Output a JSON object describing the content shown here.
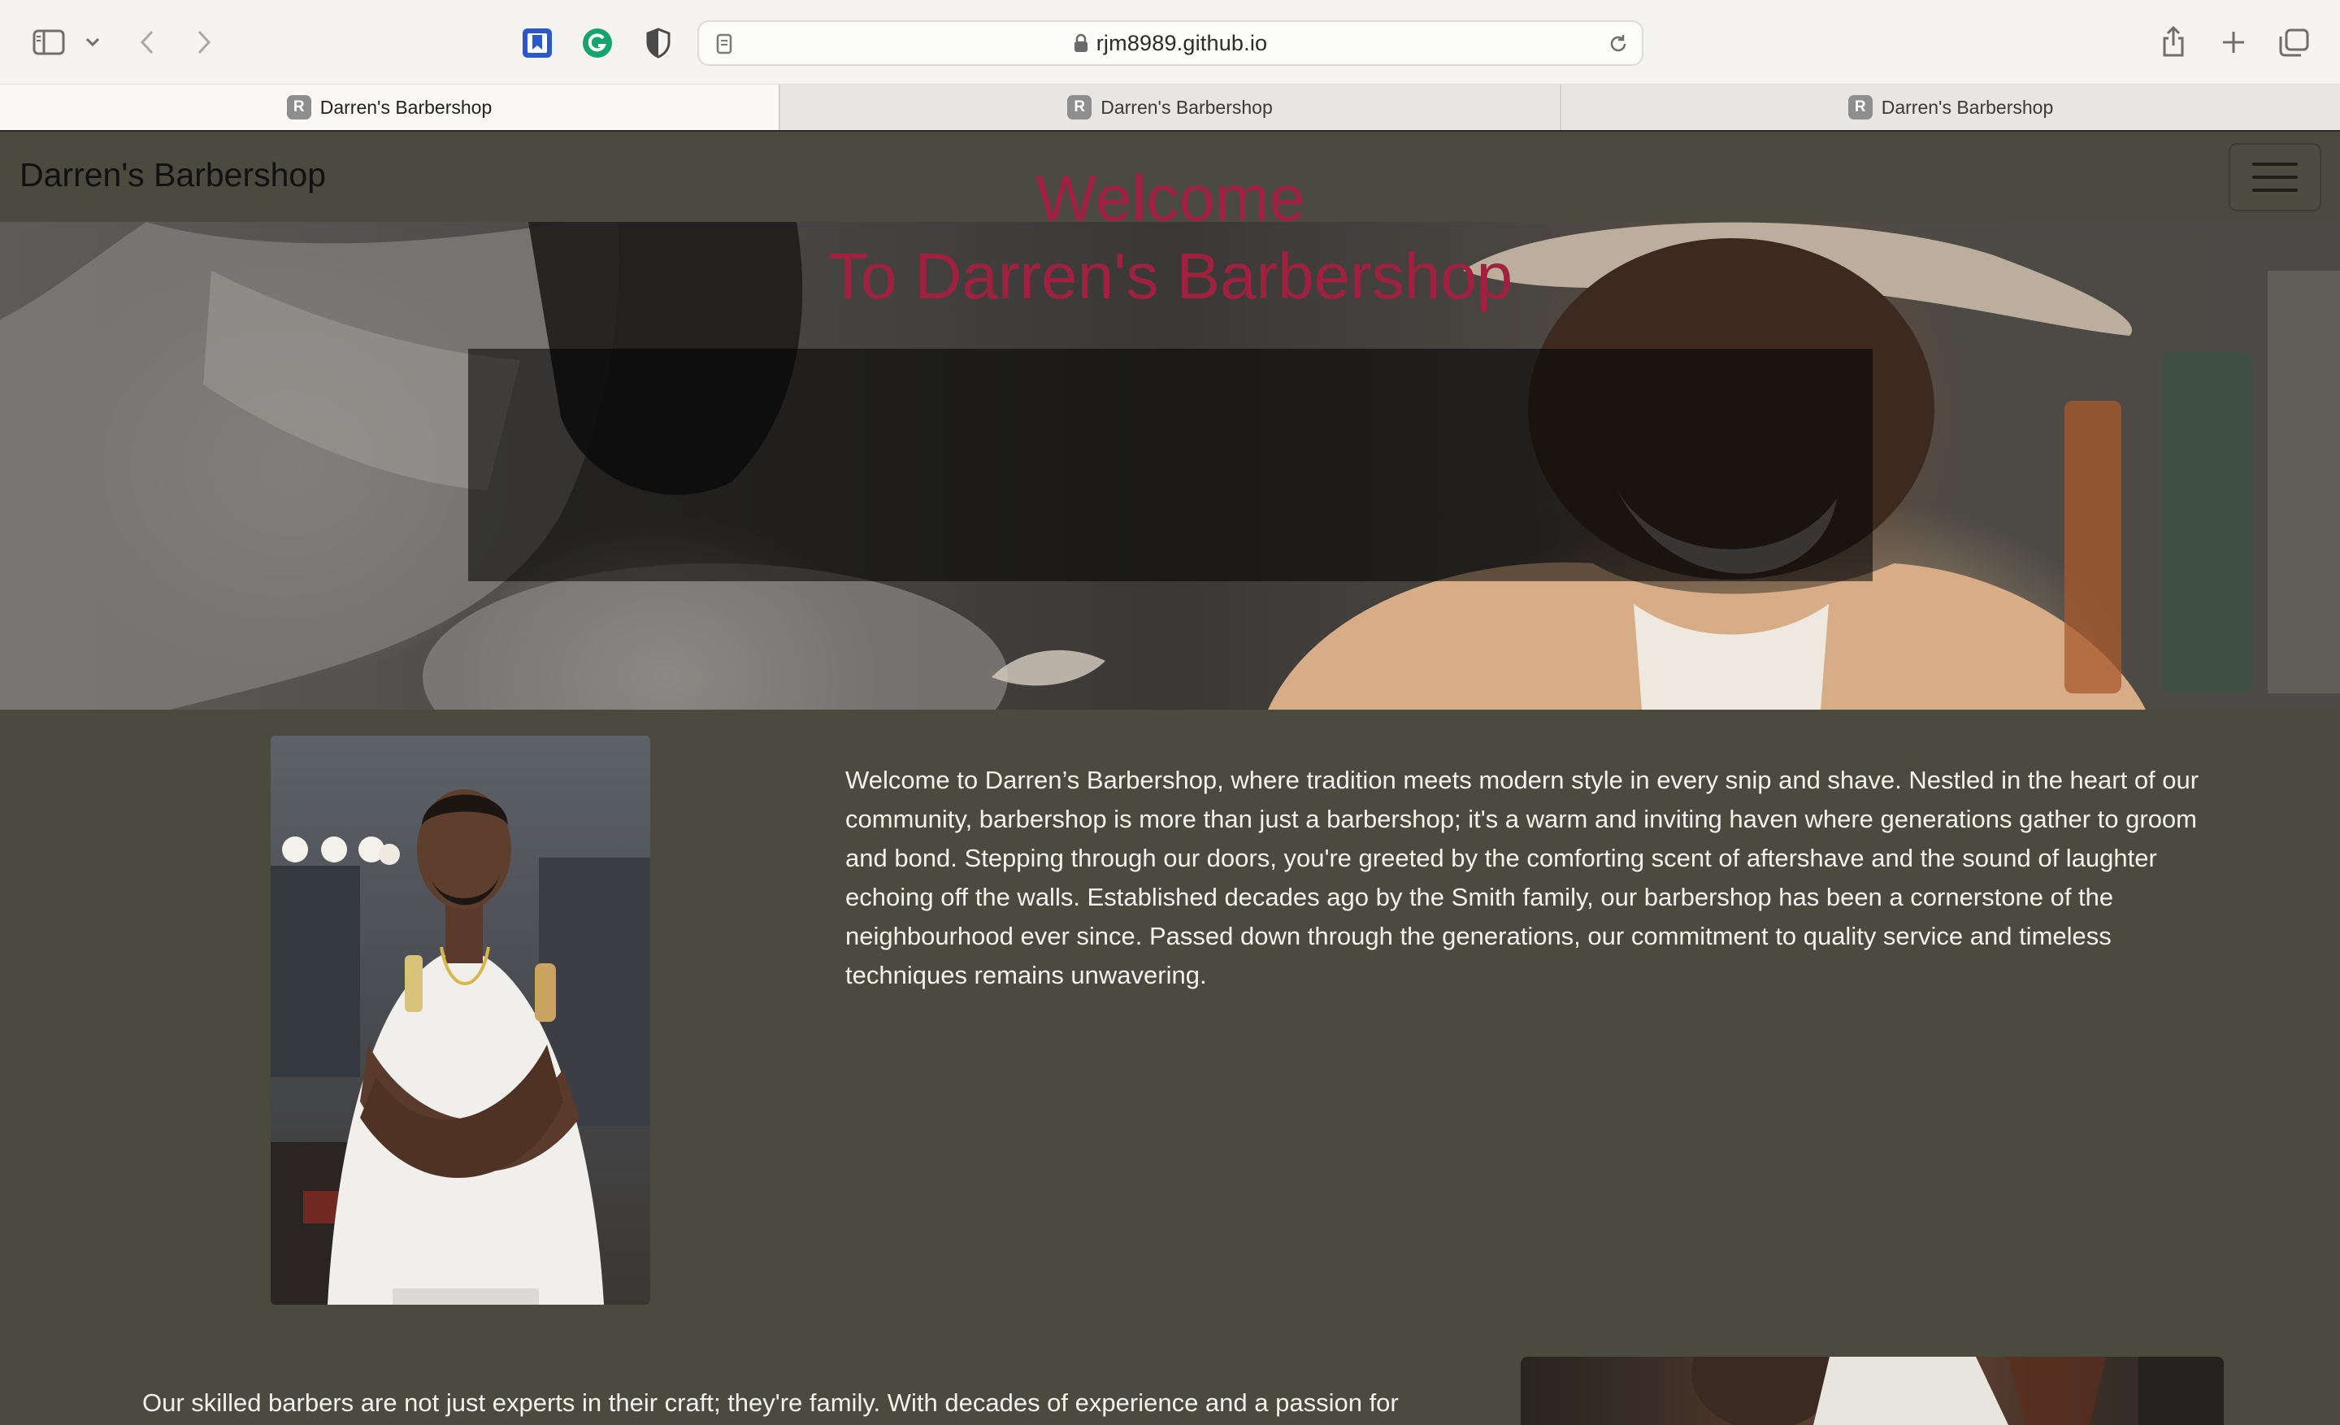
{
  "browser": {
    "url": "rjm8989.github.io",
    "tabs": [
      {
        "label": "Darren's Barbershop",
        "favicon": "R"
      },
      {
        "label": "Darren's Barbershop",
        "favicon": "R"
      },
      {
        "label": "Darren's Barbershop",
        "favicon": "R"
      }
    ]
  },
  "site": {
    "brand": "Darren's Barbershop",
    "hero": {
      "line1": "Welcome",
      "line2": "To Darren's Barbershop",
      "title_color": "#a0213f"
    },
    "intro": "Welcome to Darren’s Barbershop, where tradition meets modern style in every snip and shave. Nestled in the heart of our community, barbershop is more than just a barbershop; it's a warm and inviting haven where generations gather to groom and bond. Stepping through our doors, you're greeted by the comforting scent of aftershave and the sound of laughter echoing off the walls. Established decades ago by the Smith family, our barbershop has been a cornerstone of the neighbourhood ever since. Passed down through the generations, our commitment to quality service and timeless techniques remains unwavering.",
    "barbers": "Our skilled barbers are not just experts in their craft; they're family. With decades of experience and a passion for"
  },
  "colors": {
    "page_background": "#4a4a3f",
    "body_text": "#f1f1ee",
    "toolbar": "#f6f4f2"
  }
}
